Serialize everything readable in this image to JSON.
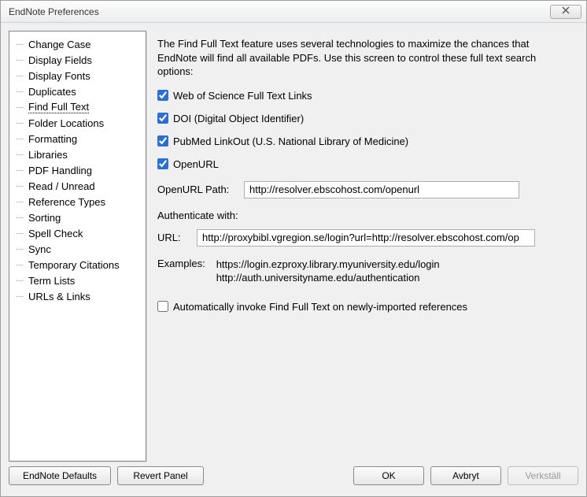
{
  "window": {
    "title": "EndNote Preferences"
  },
  "sidebar": {
    "items": [
      {
        "label": "Change Case",
        "selected": false
      },
      {
        "label": "Display Fields",
        "selected": false
      },
      {
        "label": "Display Fonts",
        "selected": false
      },
      {
        "label": "Duplicates",
        "selected": false
      },
      {
        "label": "Find Full Text",
        "selected": true
      },
      {
        "label": "Folder Locations",
        "selected": false
      },
      {
        "label": "Formatting",
        "selected": false
      },
      {
        "label": "Libraries",
        "selected": false
      },
      {
        "label": "PDF Handling",
        "selected": false
      },
      {
        "label": "Read / Unread",
        "selected": false
      },
      {
        "label": "Reference Types",
        "selected": false
      },
      {
        "label": "Sorting",
        "selected": false
      },
      {
        "label": "Spell Check",
        "selected": false
      },
      {
        "label": "Sync",
        "selected": false
      },
      {
        "label": "Temporary Citations",
        "selected": false
      },
      {
        "label": "Term Lists",
        "selected": false
      },
      {
        "label": "URLs & Links",
        "selected": false
      }
    ]
  },
  "content": {
    "description": "The Find Full Text feature uses several technologies to maximize the chances that EndNote will find all available PDFs. Use this screen to control these full text search options:",
    "options": {
      "wos": {
        "label": "Web of Science Full Text Links",
        "checked": true
      },
      "doi": {
        "label": "DOI (Digital Object Identifier)",
        "checked": true
      },
      "pubmed": {
        "label": "PubMed LinkOut (U.S. National Library of Medicine)",
        "checked": true
      },
      "openurl": {
        "label": "OpenURL",
        "checked": true
      }
    },
    "openurl_path": {
      "label": "OpenURL Path:",
      "value": "http://resolver.ebscohost.com/openurl"
    },
    "auth_label": "Authenticate with:",
    "url": {
      "label": "URL:",
      "value": "http://proxybibl.vgregion.se/login?url=http://resolver.ebscohost.com/op"
    },
    "examples": {
      "label": "Examples:",
      "line1": "https://login.ezproxy.library.myuniversity.edu/login",
      "line2": "http://auth.universityname.edu/authentication"
    },
    "auto": {
      "label": "Automatically invoke Find Full Text on newly-imported references",
      "checked": false
    }
  },
  "footer": {
    "defaults": "EndNote Defaults",
    "revert": "Revert Panel",
    "ok": "OK",
    "cancel": "Avbryt",
    "apply": "Verkställ"
  }
}
